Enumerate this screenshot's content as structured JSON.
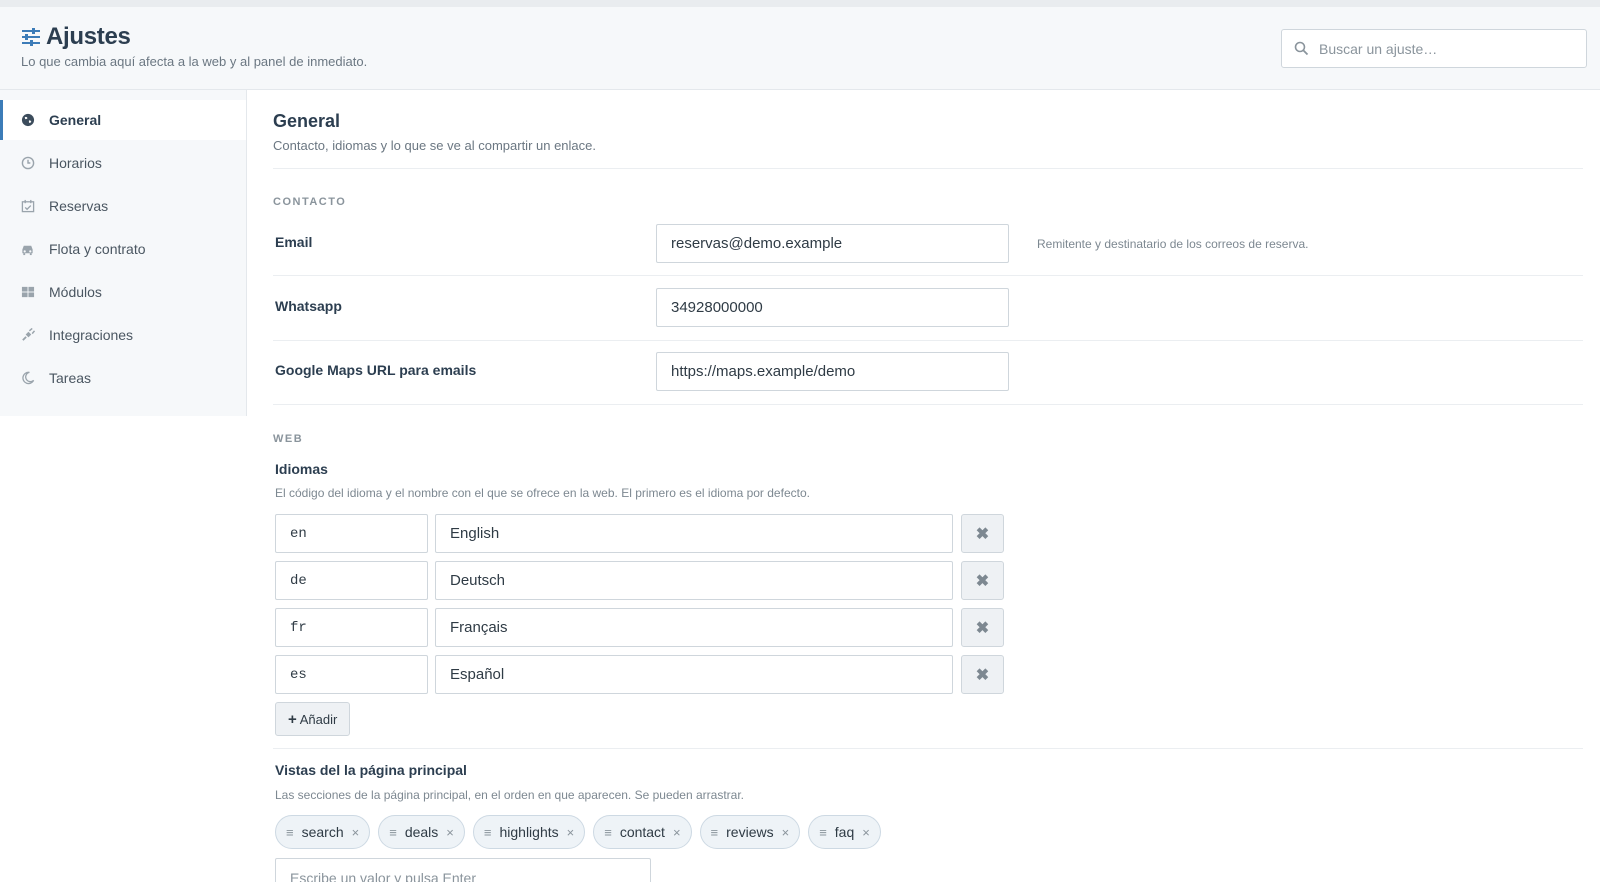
{
  "header": {
    "title": "Ajustes",
    "title_icon": "sliders-icon",
    "subtitle": "Lo que cambia aquí afecta a la web y al panel de inmediato.",
    "search_placeholder": "Buscar un ajuste…"
  },
  "sidebar": {
    "items": [
      {
        "label": "General",
        "icon": "globe-icon",
        "active": true
      },
      {
        "label": "Horarios",
        "icon": "clock-icon",
        "active": false
      },
      {
        "label": "Reservas",
        "icon": "calendar-check-icon",
        "active": false
      },
      {
        "label": "Flota y contrato",
        "icon": "car-icon",
        "active": false
      },
      {
        "label": "Módulos",
        "icon": "grid-icon",
        "active": false
      },
      {
        "label": "Integraciones",
        "icon": "plug-icon",
        "active": false
      },
      {
        "label": "Tareas",
        "icon": "moon-icon",
        "active": false
      }
    ]
  },
  "main": {
    "title": "General",
    "description": "Contacto, idiomas y lo que se ve al compartir un enlace.",
    "contact": {
      "group_label": "CONTACTO",
      "email": {
        "label": "Email",
        "value": "reservas@demo.example",
        "help": "Remitente y destinatario de los correos de reserva."
      },
      "whatsapp": {
        "label": "Whatsapp",
        "value": "34928000000"
      },
      "maps": {
        "label": "Google Maps URL para emails",
        "value": "https://maps.example/demo"
      }
    },
    "web": {
      "group_label": "WEB",
      "languages": {
        "label": "Idiomas",
        "help": "El código del idioma y el nombre con el que se ofrece en la web. El primero es el idioma por defecto.",
        "rows": [
          {
            "code": "en",
            "name": "English"
          },
          {
            "code": "de",
            "name": "Deutsch"
          },
          {
            "code": "fr",
            "name": "Français"
          },
          {
            "code": "es",
            "name": "Español"
          }
        ],
        "add_label": "Añadir"
      },
      "home_views": {
        "label": "Vistas del la página principal",
        "help": "Las secciones de la página principal, en el orden en que aparecen. Se pueden arrastrar.",
        "tags": [
          "search",
          "deals",
          "highlights",
          "contact",
          "reviews",
          "faq"
        ],
        "input_placeholder": "Escribe un valor y pulsa Enter"
      }
    }
  }
}
